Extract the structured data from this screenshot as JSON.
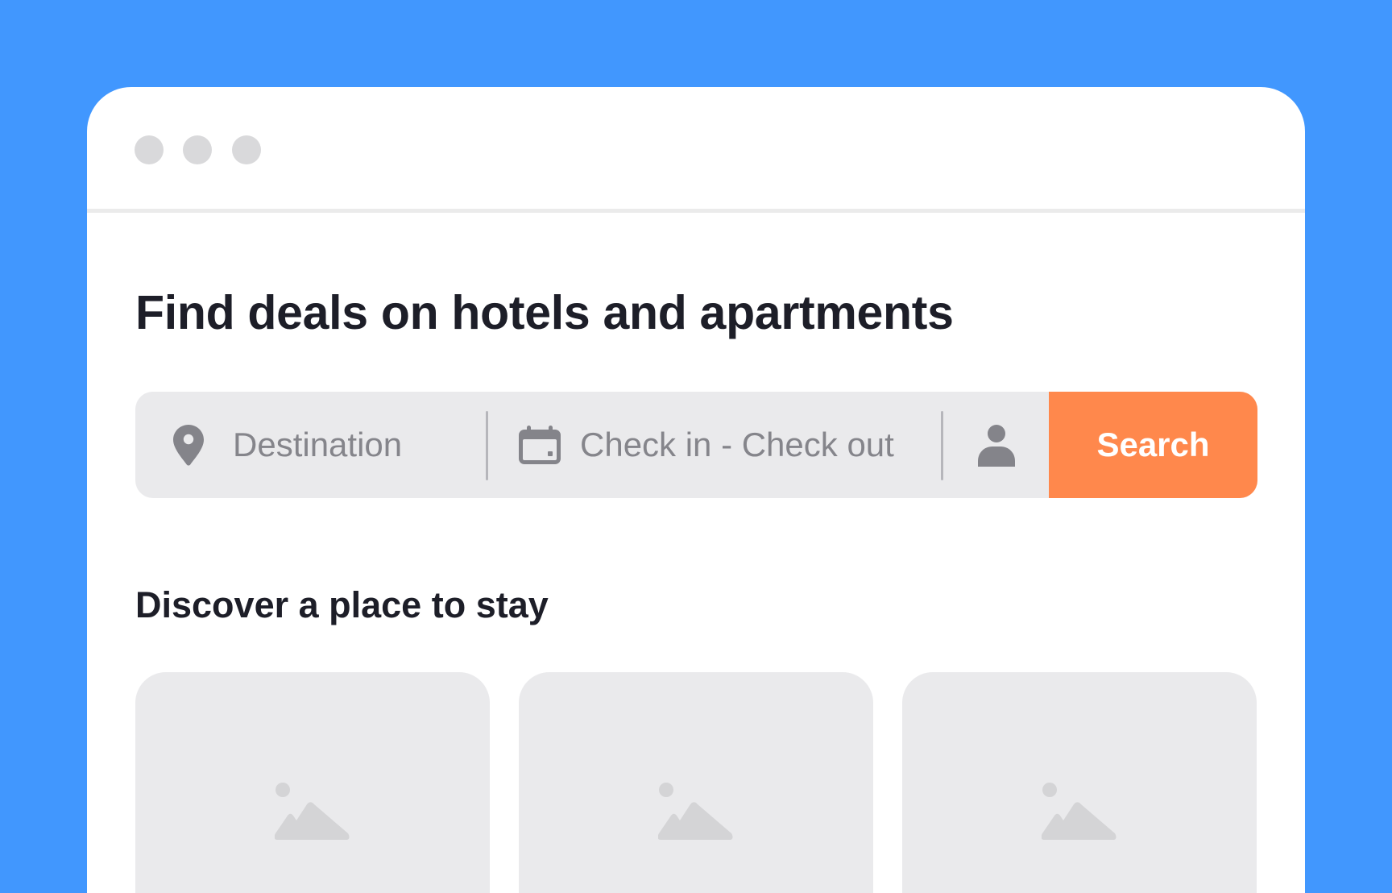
{
  "window": {
    "controls": [
      "window-dot",
      "window-dot",
      "window-dot"
    ]
  },
  "hero": {
    "title": "Find deals on hotels and apartments"
  },
  "search": {
    "destination_placeholder": "Destination",
    "dates_placeholder": "Check in - Check out",
    "guests_icon": "person-icon",
    "destination_icon": "location-pin-icon",
    "dates_icon": "calendar-icon",
    "button_label": "Search"
  },
  "discover": {
    "title": "Discover a place to stay",
    "cards": [
      {
        "image_icon": "image-placeholder-icon"
      },
      {
        "image_icon": "image-placeholder-icon"
      },
      {
        "image_icon": "image-placeholder-icon"
      }
    ]
  },
  "colors": {
    "background": "#4197fe",
    "accent": "#ff884c",
    "field_background": "#eaeaec",
    "heading": "#1d1e28",
    "placeholder": "#85858b"
  }
}
